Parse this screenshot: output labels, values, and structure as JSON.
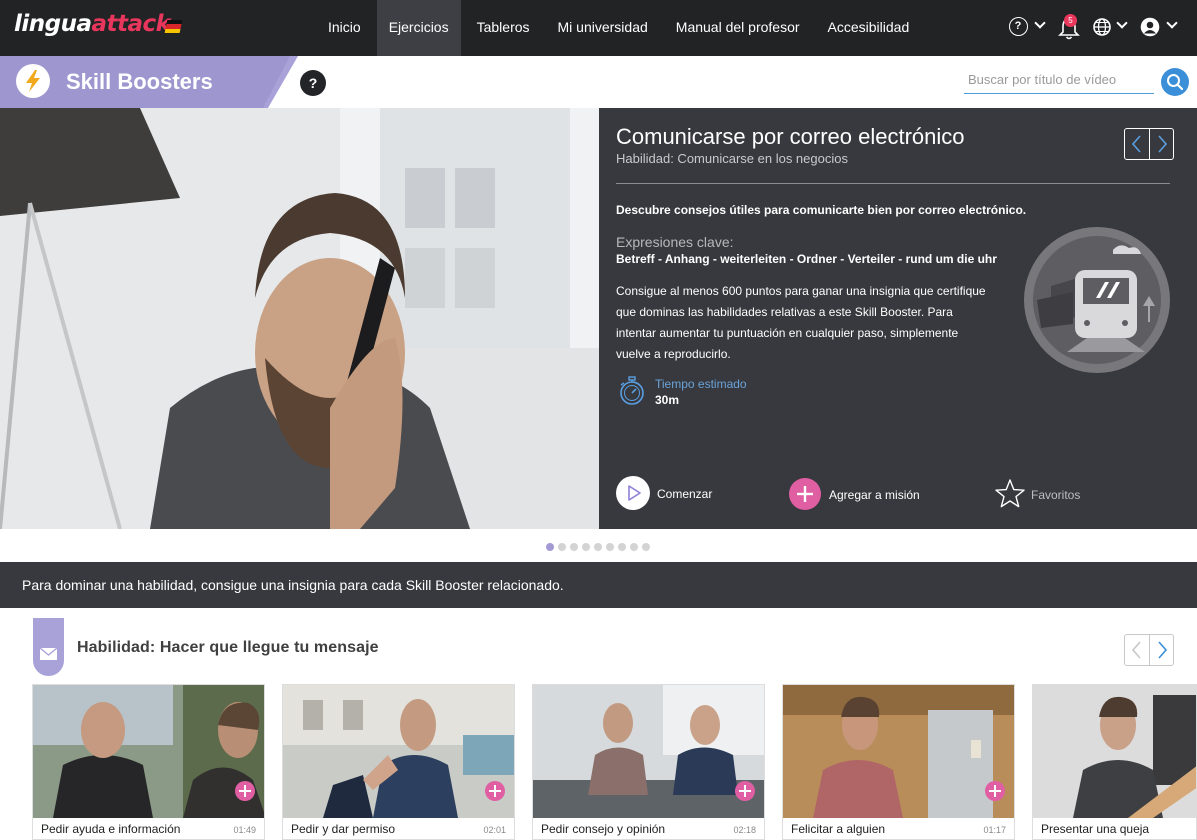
{
  "brand": {
    "name_part1": "lingua",
    "name_part2": "attack"
  },
  "nav": {
    "items": [
      {
        "label": "Inicio"
      },
      {
        "label": "Ejercicios"
      },
      {
        "label": "Tableros"
      },
      {
        "label": "Mi universidad"
      },
      {
        "label": "Manual del profesor"
      },
      {
        "label": "Accesibilidad"
      }
    ],
    "active": "Ejercicios",
    "notifications_count": "5",
    "help_symbol": "?"
  },
  "section": {
    "title": "Skill Boosters",
    "help_symbol": "?"
  },
  "search": {
    "placeholder": "Buscar por título de vídeo"
  },
  "feature": {
    "title": "Comunicarse por correo electrónico",
    "subtitle": "Habilidad: Comunicarse en los negocios",
    "description": "Descubre consejos útiles para comunicarte bien por correo electrónico.",
    "key_expressions_heading": "Expresiones clave:",
    "key_expressions": "Betreff - Anhang - weiterleiten - Ordner - Verteiler - rund um die uhr",
    "badge_text": "Consigue al menos 600 puntos para ganar una insignia que certifique que dominas las habilidades relativas a este Skill Booster. Para intentar aumentar tu puntuación en cualquier paso, simplemente vuelve a reproducirlo.",
    "time_label": "Tiempo estimado",
    "time_value": "30m",
    "actions": {
      "start": "Comenzar",
      "add_mission": "Agregar a misión",
      "favorites": "Favoritos"
    }
  },
  "carousel": {
    "dot_count": 9,
    "active_index": 0
  },
  "info": {
    "text": "Para dominar una habilidad, consigue una insignia para cada Skill Booster relacionado."
  },
  "skill": {
    "title": "Habilidad: Hacer que llegue tu mensaje",
    "cards": [
      {
        "title": "Pedir ayuda e información",
        "duration": "01:49"
      },
      {
        "title": "Pedir y dar permiso",
        "duration": "02:01"
      },
      {
        "title": "Pedir consejo y opinión",
        "duration": "02:18"
      },
      {
        "title": "Felicitar a alguien",
        "duration": "01:17"
      },
      {
        "title": "Presentar una queja",
        "duration": ""
      }
    ]
  },
  "colors": {
    "nav_bg": "#222325",
    "panel_bg": "#38393f",
    "accent_purple": "#a9a2d8",
    "accent_pink": "#e05fa3",
    "accent_blue": "#3a8fd8",
    "brand_red": "#e8365d"
  },
  "icons": [
    "help-circle-icon",
    "bell-icon",
    "globe-icon",
    "user-avatar-icon",
    "lightning-icon",
    "search-icon",
    "play-icon",
    "plus-icon",
    "star-icon",
    "stopwatch-icon",
    "train-badge-icon",
    "envelope-icon",
    "chevron-left-icon",
    "chevron-right-icon"
  ]
}
